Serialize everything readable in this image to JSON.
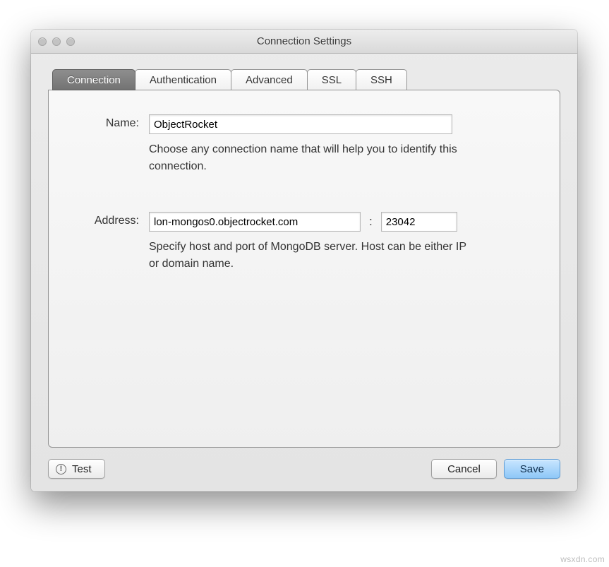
{
  "window": {
    "title": "Connection Settings"
  },
  "tabs": [
    {
      "label": "Connection",
      "active": true
    },
    {
      "label": "Authentication",
      "active": false
    },
    {
      "label": "Advanced",
      "active": false
    },
    {
      "label": "SSL",
      "active": false
    },
    {
      "label": "SSH",
      "active": false
    }
  ],
  "form": {
    "name_label": "Name:",
    "name_value": "ObjectRocket",
    "name_help": "Choose any connection name that will help you to identify this connection.",
    "address_label": "Address:",
    "address_host": "lon-mongos0.objectrocket.com",
    "address_separator": ":",
    "address_port": "23042",
    "address_help": "Specify host and port of MongoDB server. Host can be either IP or domain name."
  },
  "buttons": {
    "test": "Test",
    "cancel": "Cancel",
    "save": "Save"
  },
  "watermark": "wsxdn.com"
}
